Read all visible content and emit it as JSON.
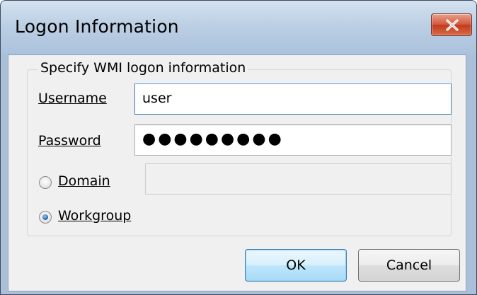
{
  "window": {
    "title": "Logon Information"
  },
  "group": {
    "legend": "Specify WMI logon information"
  },
  "fields": {
    "username_label": "Username",
    "username_value": "user",
    "password_label": "Password",
    "password_mask": "●●●●●●●●●",
    "domain_label": "Domain",
    "domain_value": "",
    "workgroup_label": "Workgroup",
    "selected_option": "Workgroup"
  },
  "buttons": {
    "ok_label": "OK",
    "cancel_label": "Cancel"
  },
  "colors": {
    "title_bar": "#bccfe4",
    "close_button": "#c13c1e",
    "default_button": "#a7d9f5"
  }
}
